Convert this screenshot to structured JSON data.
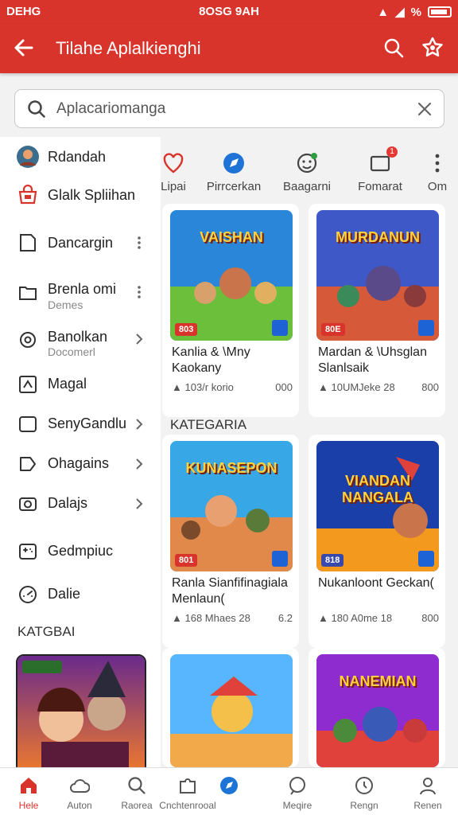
{
  "status": {
    "left": "DEHG",
    "time": "8OSG 9AH",
    "signal": "%"
  },
  "app_bar": {
    "title": "Tilahe Aplalkienghi"
  },
  "search": {
    "value": "Aplacariomanga"
  },
  "sidebar": {
    "items": [
      {
        "label": "Rdandah",
        "icon": "avatar",
        "trail": ""
      },
      {
        "label": "Glalk Spliihan",
        "icon": "store-icon",
        "trail": ""
      },
      {
        "label": "Dancargin",
        "icon": "document-icon",
        "trail": "more"
      },
      {
        "label": "Brenla omi",
        "sub": "Demes",
        "icon": "folder-icon",
        "trail": "more"
      },
      {
        "label": "Banolkan",
        "sub": "Docomerl",
        "icon": "settings-icon",
        "trail": "chevron"
      },
      {
        "label": "Magal",
        "icon": "puzzle-icon",
        "trail": ""
      },
      {
        "label": "SenyGandlu",
        "icon": "square-icon",
        "trail": "chevron"
      },
      {
        "label": "Ohagains",
        "icon": "tag-icon",
        "trail": "chevron"
      },
      {
        "label": "Dalajs",
        "icon": "camera-icon",
        "trail": "chevron"
      },
      {
        "label": "Gedmpiuc",
        "icon": "gamepad-icon",
        "trail": ""
      },
      {
        "label": "Dalie",
        "icon": "dashboard-icon",
        "trail": ""
      }
    ],
    "heading": "KATGBAI"
  },
  "categories": [
    {
      "label": "Lipai",
      "icon": "heart-icon"
    },
    {
      "label": "Pirrcerkan",
      "icon": "compass-icon"
    },
    {
      "label": "Baagarni",
      "icon": "face-icon",
      "badge": ""
    },
    {
      "label": "Fomarat",
      "icon": "message-icon",
      "badge": "1"
    },
    {
      "label": "Om",
      "icon": "more-icon"
    }
  ],
  "section_heading": "KATEGARIA",
  "games": [
    {
      "title": "Kanlia & \\Mny Kaokany",
      "meta": "103/r korio",
      "val": "000",
      "tag": "803",
      "banner": "VAISHAN",
      "colors": [
        "#2a86d8",
        "#6bbf3a"
      ]
    },
    {
      "title": "Mardan & \\Uhsglan Slanlsaik",
      "meta": "10UMJeke 28",
      "val": "800",
      "tag": "80E",
      "banner": "MURDANUN",
      "colors": [
        "#3f58c8",
        "#d65a3a"
      ]
    },
    {
      "title": "Ranla Sianfifinagiala Menlaun(",
      "meta": "168 Mhaes 28",
      "val": "6.2",
      "tag": "801",
      "banner": "KUNASEPON",
      "colors": [
        "#37a7e6",
        "#e0894a"
      ]
    },
    {
      "title": "Nukanloont Geckan(",
      "meta": "180 A0me 18",
      "val": "800",
      "tag": "818",
      "banner": "VIANDAN NANGALA",
      "colors": [
        "#1b3fa8",
        "#f39a1e"
      ],
      "tagBlue": true
    },
    {
      "title": "",
      "meta": "",
      "val": "",
      "tag": "",
      "banner": "",
      "colors": [
        "#58b6ff",
        "#f2a94a"
      ]
    },
    {
      "title": "",
      "meta": "",
      "val": "",
      "tag": "",
      "banner": "NANEMIAN",
      "colors": [
        "#8e2ccf",
        "#e0413a"
      ]
    }
  ],
  "bottom_nav": [
    {
      "label": "Hele",
      "icon": "home-icon",
      "active": true
    },
    {
      "label": "Auton",
      "icon": "cloud-icon"
    },
    {
      "label": "Raorea",
      "icon": "search-icon"
    },
    {
      "label": "Cnchtenrooal",
      "icon": "puzzle-icon"
    },
    {
      "label": "Meqire",
      "icon": "chat-icon"
    },
    {
      "label": "Rengn",
      "icon": "clock-icon"
    },
    {
      "label": "Renen",
      "icon": "profile-icon"
    }
  ],
  "colors": {
    "brand": "#d9342b",
    "accent": "#1e63d6"
  }
}
